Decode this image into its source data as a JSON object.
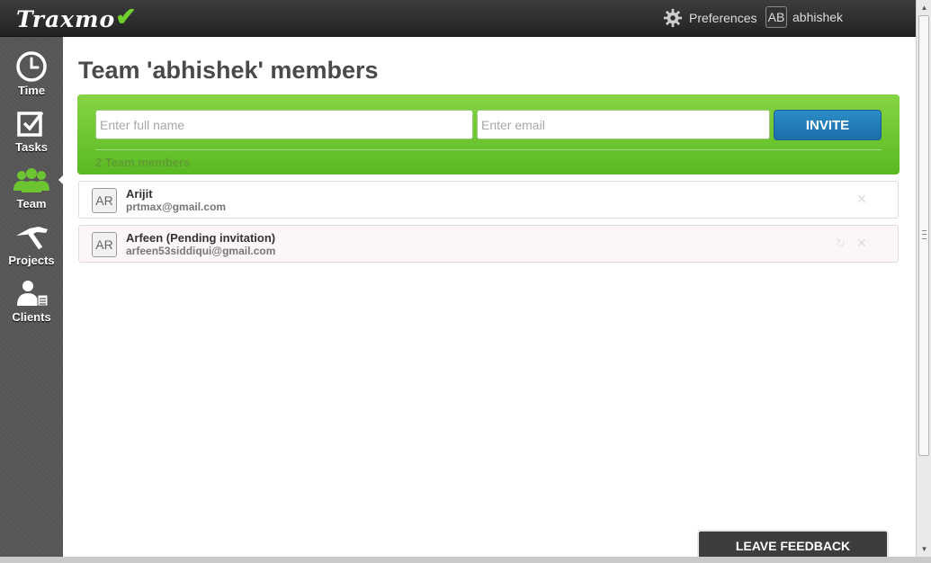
{
  "header": {
    "logo": "Traxmo",
    "preferences_label": "Preferences",
    "user_initials": "AB",
    "username": "abhishek"
  },
  "sidebar": {
    "items": [
      {
        "label": "Time",
        "icon": "clock-icon"
      },
      {
        "label": "Tasks",
        "icon": "checkbox-icon"
      },
      {
        "label": "Team",
        "icon": "team-icon",
        "active": true
      },
      {
        "label": "Projects",
        "icon": "hammer-icon"
      },
      {
        "label": "Clients",
        "icon": "client-icon"
      }
    ]
  },
  "main": {
    "title": "Team 'abhishek' members",
    "invite": {
      "name_placeholder": "Enter full name",
      "email_placeholder": "Enter email",
      "button_label": "INVITE",
      "member_count": "2 Team members"
    },
    "members": [
      {
        "initials": "AR",
        "name": "Arijit",
        "email": "prtmax@gmail.com",
        "pending": false
      },
      {
        "initials": "AR",
        "name": "Arfeen (Pending invitation)",
        "email": "arfeen53siddiqui@gmail.com",
        "pending": true
      }
    ]
  },
  "feedback_label": "LEAVE FEEDBACK",
  "colors": {
    "accent_green": "#6cc431",
    "invite_blue": "#2283be",
    "topbar": "#2e2e2e",
    "sidebar": "#575757"
  }
}
